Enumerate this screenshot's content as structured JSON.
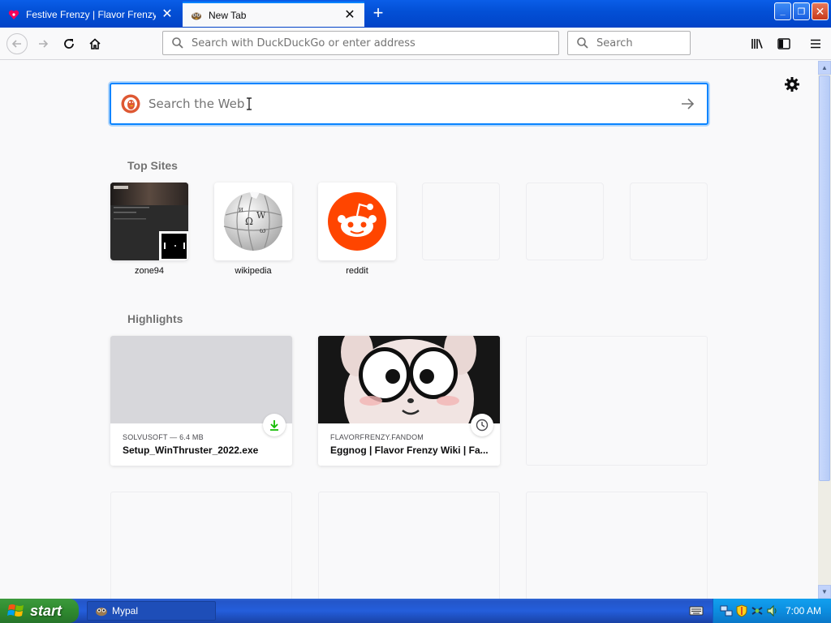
{
  "browser": {
    "tabs": [
      {
        "title": "Festive Frenzy | Flavor Frenzy Wiki",
        "icon": "fandom-heart-icon",
        "active": false
      },
      {
        "title": "New Tab",
        "icon": "mypal-icon",
        "active": true
      }
    ],
    "tab_close_glyph": "✕",
    "new_tab_glyph": "+",
    "window_controls": {
      "minimize": "_",
      "maximize": "❐",
      "close": "✕"
    },
    "url_placeholder": "Search with DuckDuckGo or enter address",
    "search_placeholder": "Search"
  },
  "newtab": {
    "web_search_placeholder": "Search the Web",
    "top_sites_title": "Top Sites",
    "top_sites": [
      {
        "label": "zone94",
        "icon": "zone94-thumbnail"
      },
      {
        "label": "wikipedia",
        "icon": "wikipedia-globe-icon"
      },
      {
        "label": "reddit",
        "icon": "reddit-icon"
      },
      {
        "label": "",
        "icon": ""
      },
      {
        "label": "",
        "icon": ""
      },
      {
        "label": "",
        "icon": ""
      }
    ],
    "highlights_title": "Highlights",
    "highlights": [
      {
        "source": "SOLVUSOFT — 6.4 MB",
        "title": "Setup_WinThruster_2022.exe",
        "badge": "download-icon"
      },
      {
        "source": "FLAVORFRENZY.FANDOM",
        "title": "Eggnog | Flavor Frenzy Wiki | Fa...",
        "badge": "history-clock-icon"
      }
    ]
  },
  "taskbar": {
    "start_label": "start",
    "tasks": [
      {
        "label": "Mypal",
        "icon": "mypal-icon"
      }
    ],
    "clock": "7:00 AM"
  },
  "colors": {
    "accent": "#0a84ff",
    "xp_blue": "#245edb",
    "start_green": "#2f8a2f",
    "reddit_orange": "#ff4500"
  }
}
